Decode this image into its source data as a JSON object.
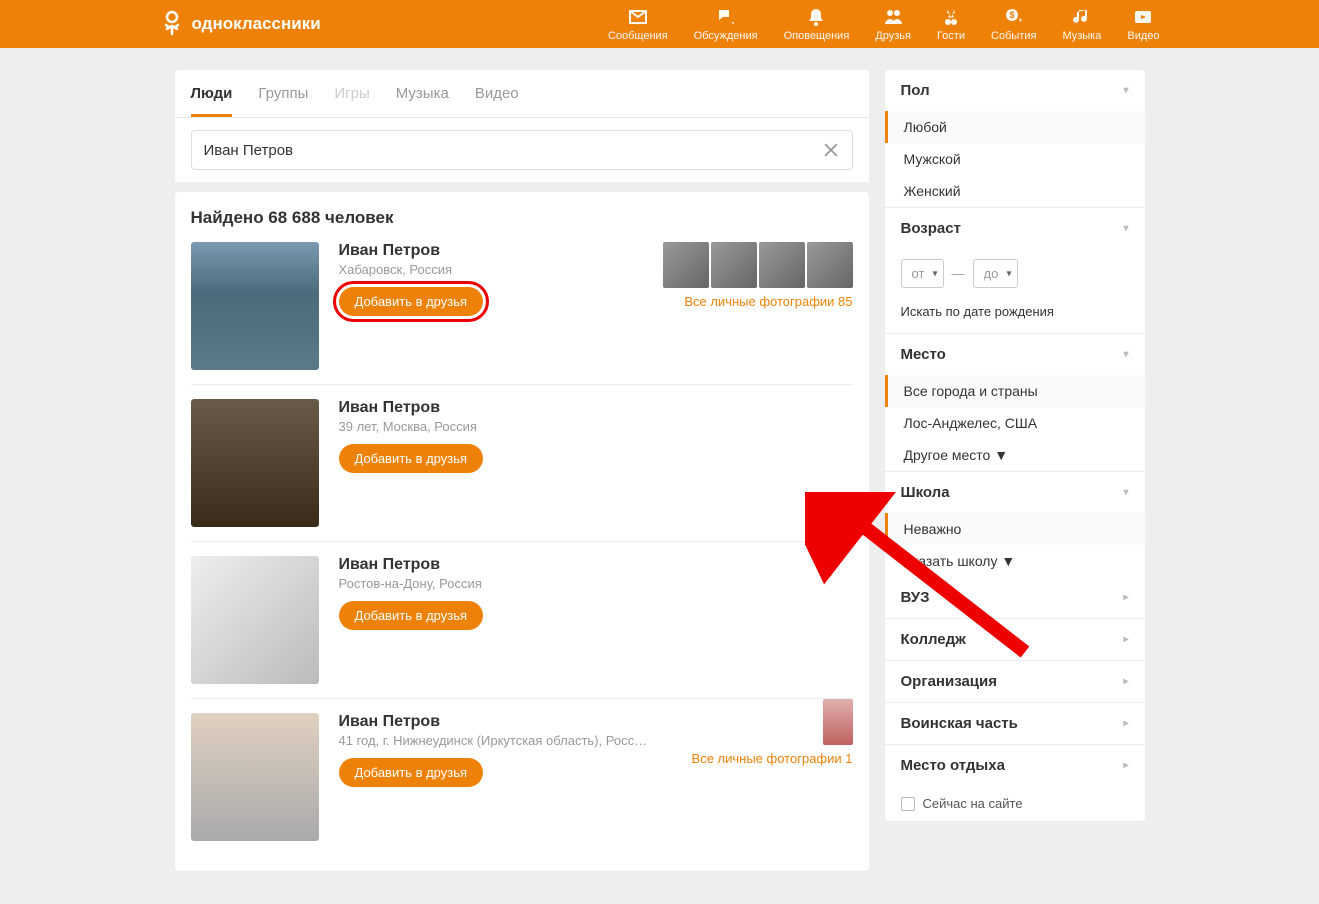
{
  "brand": "одноклассники",
  "nav": [
    {
      "label": "Сообщения",
      "name": "nav-messages"
    },
    {
      "label": "Обсуждения",
      "name": "nav-discussions"
    },
    {
      "label": "Оповещения",
      "name": "nav-notifications"
    },
    {
      "label": "Друзья",
      "name": "nav-friends"
    },
    {
      "label": "Гости",
      "name": "nav-guests"
    },
    {
      "label": "События",
      "name": "nav-events"
    },
    {
      "label": "Музыка",
      "name": "nav-music"
    },
    {
      "label": "Видео",
      "name": "nav-video"
    }
  ],
  "tabs": [
    {
      "label": "Люди",
      "active": true
    },
    {
      "label": "Группы"
    },
    {
      "label": "Игры",
      "disabled": true
    },
    {
      "label": "Музыка"
    },
    {
      "label": "Видео"
    }
  ],
  "search": {
    "value": "Иван Петров"
  },
  "results_count": "Найдено 68 688 человек",
  "add_label": "Добавить в друзья",
  "results": [
    {
      "name": "Иван Петров",
      "loc": "Хабаровск, Россия",
      "photos_label": "Все личные фотографии 85",
      "hl": true,
      "thumbs": 4
    },
    {
      "name": "Иван Петров",
      "loc": "39 лет, Москва, Россия"
    },
    {
      "name": "Иван Петров",
      "loc": "Ростов-на-Дону, Россия"
    },
    {
      "name": "Иван Петров",
      "loc": "41 год, г. Нижнеудинск (Иркутская область), Росс…",
      "photos_label": "Все личные фотографии 1",
      "small_thumb": true
    }
  ],
  "filters": {
    "gender": {
      "title": "Пол",
      "options": [
        "Любой",
        "Мужской",
        "Женский"
      ],
      "active": "Любой"
    },
    "age": {
      "title": "Возраст",
      "from": "от",
      "to": "до",
      "birth": "Искать по дате рождения"
    },
    "place": {
      "title": "Место",
      "options": [
        "Все города и страны",
        "Лос-Анджелес, США"
      ],
      "other": "Другое место ▼",
      "active": "Все города и страны"
    },
    "school": {
      "title": "Школа",
      "options": [
        "Неважно"
      ],
      "other": "Указать школу ▼",
      "active": "Неважно"
    },
    "sections": [
      "ВУЗ",
      "Колледж",
      "Организация",
      "Воинская часть",
      "Место отдыха"
    ],
    "online": "Сейчас на сайте"
  }
}
